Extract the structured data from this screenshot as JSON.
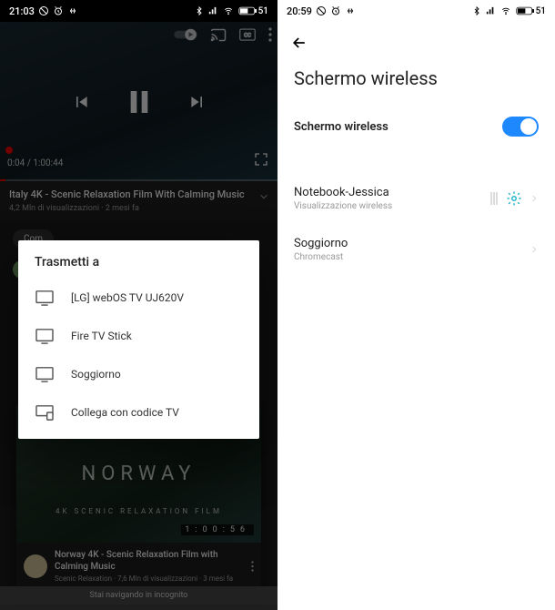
{
  "left": {
    "status": {
      "time": "21:03",
      "battery": "51"
    },
    "video": {
      "title": "Italy 4K - Scenic Relaxation Film With Calming Music",
      "subline": "4,2 Mln di visualizzazioni · 2 mesi fa",
      "timecode": "0:04 / 1:00:44"
    },
    "modal": {
      "title": "Trasmetti a",
      "items": [
        "[LG] webOS TV UJ620V",
        "Fire TV Stick",
        "Soggiorno",
        "Collega con codice TV"
      ]
    },
    "card2": {
      "thumb_text": "NORWAY",
      "thumb_sub": "4K SCENIC RELAXATION FILM",
      "duration": "1:00:56",
      "title": "Norway 4K - Scenic Relaxation Film with Calming Music",
      "subline": "Scenic Relaxation · 7,6 Mln di visualizzazioni · 3 mesi fa"
    },
    "strip_label": "Com",
    "incognito": "Stai navigando in incognito"
  },
  "right": {
    "status": {
      "time": "20:59",
      "battery": "51"
    },
    "title": "Schermo wireless",
    "rows": {
      "toggle_label": "Schermo wireless",
      "device1": {
        "name": "Notebook-Jessica",
        "sub": "Visualizzazione wireless"
      },
      "device2": {
        "name": "Soggiorno",
        "sub": "Chromecast"
      }
    }
  }
}
